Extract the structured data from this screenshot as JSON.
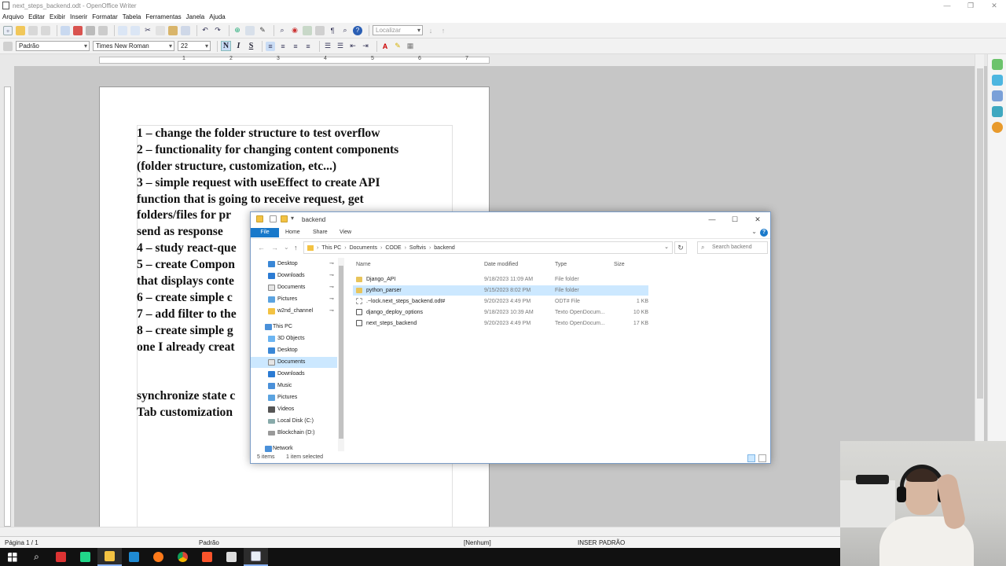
{
  "window": {
    "title": "next_steps_backend.odt - OpenOffice Writer",
    "controls": [
      "—",
      "❐",
      "✕"
    ]
  },
  "menu": [
    "Arquivo",
    "Editar",
    "Exibir",
    "Inserir",
    "Formatar",
    "Tabela",
    "Ferramentas",
    "Janela",
    "Ajuda"
  ],
  "toolbar": {
    "find_placeholder": "Localizar",
    "paragraph_style": "Padrão",
    "font_name": "Times New Roman",
    "font_size": "22",
    "bold": "N",
    "italic": "I",
    "underline": "S"
  },
  "ruler": [
    "1",
    "2",
    "3",
    "4",
    "5",
    "6",
    "7"
  ],
  "document": {
    "lines": [
      "1 – change the folder structure to test overflow",
      "2 – functionality for changing content components",
      "(folder structure, customization, etc...)",
      "3 – simple request with useEffect to create API",
      "function that is going to receive request, get",
      "folders/files for pr",
      "send as response",
      "4 – study react-que",
      "5 – create Compon",
      "that displays conte",
      "6 – create simple c",
      "7 – add filter to the",
      "8 – create simple g",
      "one I already creat",
      "",
      "",
      "synchronize state c",
      "Tab customization"
    ]
  },
  "status": {
    "page": "Página 1 / 1",
    "style": "Padrão",
    "language": "[Nenhum]",
    "insert": "INSER",
    "selection": "PADRÃO"
  },
  "explorer": {
    "title": "backend",
    "ribbon_tabs": [
      "File",
      "Home",
      "Share",
      "View"
    ],
    "help": "?",
    "breadcrumb": [
      "This PC",
      "Documents",
      "CODE",
      "Softvis",
      "backend"
    ],
    "search_placeholder": "Search backend",
    "nav": {
      "quick_access": [
        {
          "label": "Desktop",
          "pinned": true
        },
        {
          "label": "Downloads",
          "pinned": true
        },
        {
          "label": "Documents",
          "pinned": true
        },
        {
          "label": "Pictures",
          "pinned": true
        },
        {
          "label": "w2nd_channel",
          "pinned": true
        }
      ],
      "this_pc": "This PC",
      "this_pc_items": [
        "3D Objects",
        "Desktop",
        "Documents",
        "Downloads",
        "Music",
        "Pictures",
        "Videos",
        "Local Disk (C:)",
        "Blockchain (D:)"
      ],
      "network": "Network"
    },
    "columns": {
      "name": "Name",
      "date": "Date modified",
      "type": "Type",
      "size": "Size"
    },
    "files": [
      {
        "name": "Django_API",
        "date": "9/18/2023 11:09 AM",
        "type": "File folder",
        "size": "",
        "kind": "folder"
      },
      {
        "name": "python_parser",
        "date": "9/15/2023 8:02 PM",
        "type": "File folder",
        "size": "",
        "kind": "folder",
        "selected": true
      },
      {
        "name": ".~lock.next_steps_backend.odt#",
        "date": "9/20/2023 4:49 PM",
        "type": "ODT# File",
        "size": "1 KB",
        "kind": "lock"
      },
      {
        "name": "django_deploy_options",
        "date": "9/18/2023 10:39 AM",
        "type": "Texto OpenDocum...",
        "size": "10 KB",
        "kind": "doc"
      },
      {
        "name": "next_steps_backend",
        "date": "9/20/2023 4:49 PM",
        "type": "Texto OpenDocum...",
        "size": "17 KB",
        "kind": "doc"
      }
    ],
    "status_items": "5 items",
    "status_selected": "1 item selected"
  },
  "colors": {
    "selection": "#cce8ff",
    "accent": "#1979ca",
    "folder": "#e8c45a"
  }
}
